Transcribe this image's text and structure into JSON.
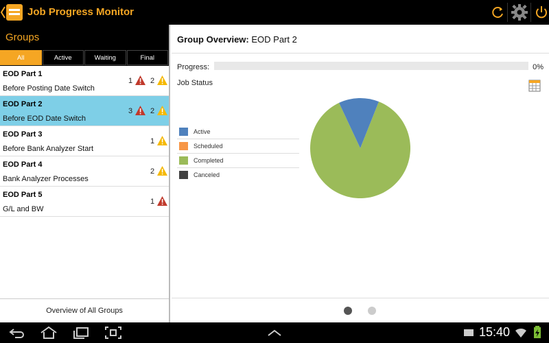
{
  "app": {
    "title": "Job Progress Monitor",
    "accent_color": "#f5a623",
    "icons": [
      "back-chevron-icon",
      "app-logo-icon",
      "refresh-icon",
      "settings-icon",
      "power-icon"
    ]
  },
  "groups_panel": {
    "header": "Groups",
    "filters": [
      {
        "label": "All",
        "selected": true
      },
      {
        "label": "Active",
        "selected": false
      },
      {
        "label": "Waiting",
        "selected": false
      },
      {
        "label": "Final",
        "selected": false
      }
    ],
    "items": [
      {
        "name": "EOD Part 1",
        "subtitle": "Before Posting Date Switch",
        "error_count": "1",
        "warning_count": "2",
        "selected": false
      },
      {
        "name": "EOD Part 2",
        "subtitle": "Before EOD Date Switch",
        "error_count": "3",
        "warning_count": "2",
        "selected": true
      },
      {
        "name": "EOD Part 3",
        "subtitle": "Before Bank Analyzer Start",
        "error_count": "",
        "warning_count": "1",
        "selected": false
      },
      {
        "name": "EOD Part 4",
        "subtitle": "Bank Analyzer Processes",
        "error_count": "",
        "warning_count": "2",
        "selected": false
      },
      {
        "name": "EOD Part 5",
        "subtitle": "G/L and BW",
        "error_count": "1",
        "warning_count": "",
        "selected": false
      }
    ],
    "footer_link": "Overview of All Groups"
  },
  "overview": {
    "title_prefix": "Group Overview:",
    "group_name": "EOD Part 2",
    "progress_label": "Progress:",
    "progress_value": "0%",
    "progress_fraction": 0,
    "job_status_label": "Job Status",
    "page_count": 2,
    "current_page": 1
  },
  "chart_data": {
    "type": "pie",
    "title": "",
    "categories": [
      "Active",
      "Scheduled",
      "Completed",
      "Canceled"
    ],
    "colors": [
      "#4f81bd",
      "#f79646",
      "#9bbb59",
      "#404040"
    ],
    "values": [
      0.13,
      0,
      0.87,
      0
    ],
    "legend_position": "left"
  },
  "statusbar": {
    "time": "15:40",
    "icons": [
      "back-nav-icon",
      "home-nav-icon",
      "recent-apps-icon",
      "screenshot-icon",
      "up-chevron-icon",
      "wifi-icon",
      "battery-icon"
    ]
  }
}
